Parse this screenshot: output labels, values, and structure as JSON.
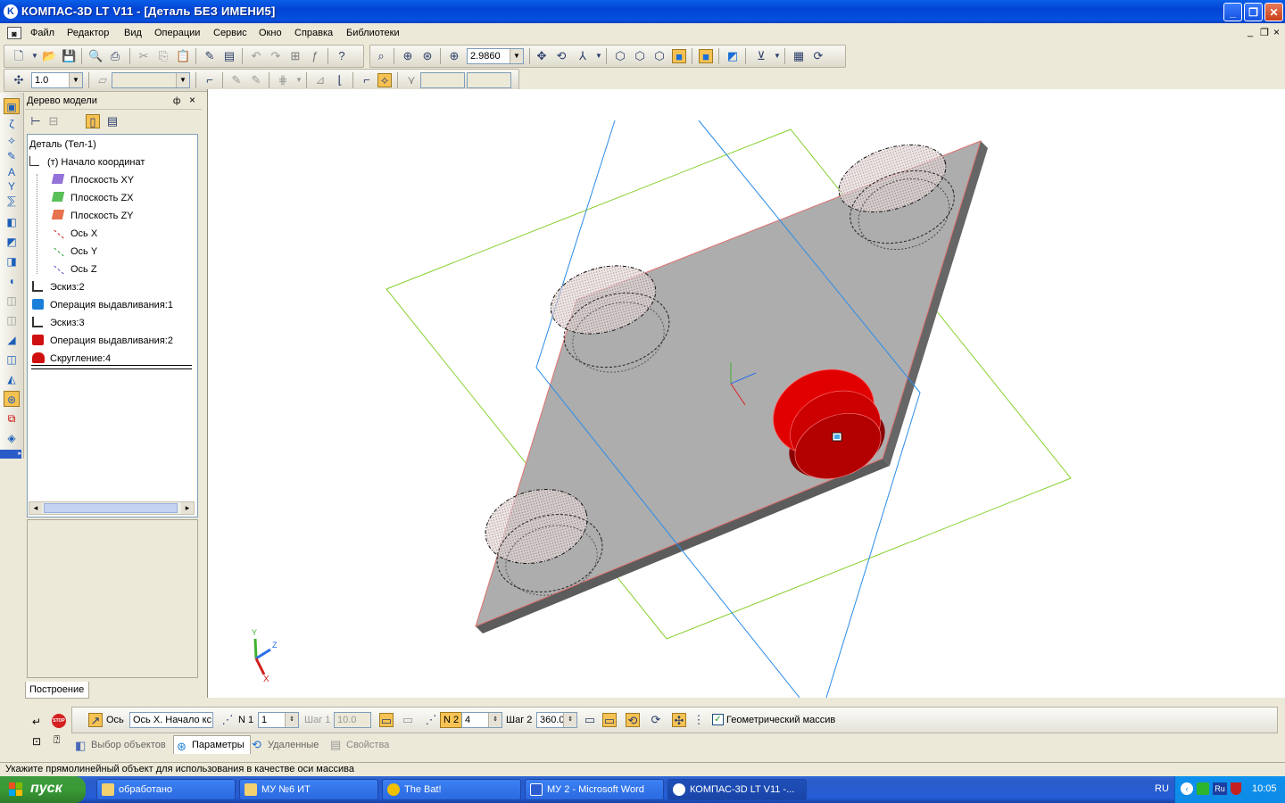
{
  "window": {
    "title": "КОМПАС-3D LT V11 - [Деталь БЕЗ ИМЕНИ5]",
    "app_icon_letter": "K"
  },
  "menu": {
    "items": [
      "Файл",
      "Редактор",
      "Вид",
      "Операции",
      "Сервис",
      "Окно",
      "Справка",
      "Библиотеки"
    ]
  },
  "toolbar": {
    "zoom_value": "2.9860",
    "step_value": "1.0"
  },
  "tree": {
    "panel_title": "Дерево модели",
    "pin_glyph": "ф",
    "close_glyph": "×",
    "items": [
      {
        "label": "Деталь (Тел-1)"
      },
      {
        "label": "(т) Начало координат"
      },
      {
        "label": "Плоскость XY"
      },
      {
        "label": "Плоскость ZX"
      },
      {
        "label": "Плоскость ZY"
      },
      {
        "label": "Ось X"
      },
      {
        "label": "Ось Y"
      },
      {
        "label": "Ось Z"
      },
      {
        "label": "Эскиз:2"
      },
      {
        "label": "Операция выдавливания:1"
      },
      {
        "label": "Эскиз:3"
      },
      {
        "label": "Операция выдавливания:2"
      },
      {
        "label": "Скругление:4"
      }
    ],
    "bottom_tab": "Построение"
  },
  "properties": {
    "axis_label": "Ось",
    "axis_value": "Ось X. Начало кс",
    "n1_label": "N 1",
    "n1_value": "1",
    "step1_label": "Шаг 1",
    "step1_value": "10.0",
    "n2_label": "N 2",
    "n2_value": "4",
    "step2_label": "Шаг 2",
    "step2_value": "360.0",
    "geometric_array_label": "Геометрический массив",
    "geometric_array_checked": true,
    "stop_label": "STOP",
    "tabs": [
      "Выбор объектов",
      "Параметры",
      "Удаленные",
      "Свойства"
    ],
    "active_tab": 1
  },
  "status": {
    "text": "Укажите прямолинейный объект для использования в качестве оси массива"
  },
  "triad": {
    "x": "X",
    "y": "Y",
    "z": "Z"
  },
  "taskbar": {
    "start_label": "пуск",
    "tasks": [
      "обработано",
      "МУ №6 ИТ",
      "The Bat!",
      "МУ 2 - Microsoft Word",
      "КОМПАС-3D LT V11 -..."
    ],
    "active_task": 4,
    "language": "RU",
    "tray_lang": "Ru",
    "clock": "10:05"
  },
  "colors": {
    "title_blue": "#0a50e0",
    "plate_grey": "#aaaaaa",
    "extrude_red": "#d00000",
    "plane_green": "#80d020",
    "plane_blue": "#2a8ce8"
  }
}
